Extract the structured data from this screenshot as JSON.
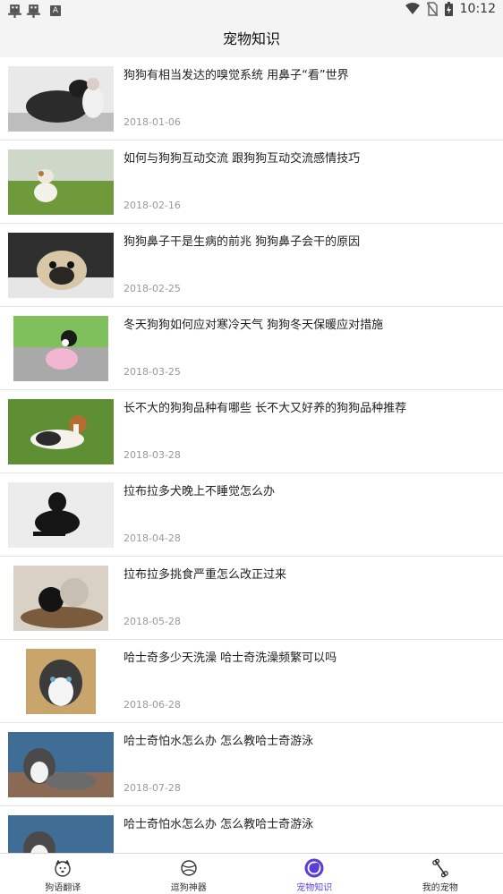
{
  "status_bar": {
    "time": "10:12",
    "left_icons": [
      "bug-icon",
      "bug-icon",
      "a-notification-icon"
    ],
    "right_icons": [
      "wifi-icon",
      "no-sim-icon",
      "battery-icon"
    ]
  },
  "header": {
    "title": "宠物知识"
  },
  "articles": [
    {
      "title": "狗狗有相当发达的嗅觉系统 用鼻子“看”世界",
      "date": "2018-01-06",
      "thumb": "dog-hugging-child-photo"
    },
    {
      "title": "如何与狗狗互动交流 跟狗狗互动交流感情技巧",
      "date": "2018-02-16",
      "thumb": "terrier-on-grass-photo"
    },
    {
      "title": "狗狗鼻子干是生病的前兆 狗狗鼻子会干的原因",
      "date": "2018-02-25",
      "thumb": "pug-lying-photo"
    },
    {
      "title": "冬天狗狗如何应对寒冷天气 狗狗冬天保暖应对措施",
      "date": "2018-03-25",
      "thumb": "dog-in-pink-sweater-photo"
    },
    {
      "title": "长不大的狗狗品种有哪些 长不大又好养的狗狗品种推荐",
      "date": "2018-03-28",
      "thumb": "beagle-on-grass-photo"
    },
    {
      "title": "拉布拉多犬晚上不睡觉怎么办",
      "date": "2018-04-28",
      "thumb": "black-labrador-photo"
    },
    {
      "title": "拉布拉多挑食严重怎么改正过来",
      "date": "2018-05-28",
      "thumb": "poodles-in-basket-photo"
    },
    {
      "title": "哈士奇多少天洗澡 哈士奇洗澡频繁可以吗",
      "date": "2018-06-28",
      "thumb": "husky-face-photo"
    },
    {
      "title": "哈士奇怕水怎么办 怎么教哈士奇游泳",
      "date": "2018-07-28",
      "thumb": "husky-lying-photo"
    },
    {
      "title": "哈士奇怕水怎么办 怎么教哈士奇游泳",
      "date": "",
      "thumb": "husky-lying-photo"
    }
  ],
  "bottom_nav": [
    {
      "label": "狗语翻译",
      "icon": "dog-face-icon",
      "active": false
    },
    {
      "label": "逗狗神器",
      "icon": "ball-icon",
      "active": false
    },
    {
      "label": "宠物知识",
      "icon": "knowledge-icon",
      "active": true
    },
    {
      "label": "我的宠物",
      "icon": "bone-icon",
      "active": false
    }
  ],
  "colors": {
    "accent": "#5a3fd6",
    "divider": "#e2e2e2",
    "date_text": "#999999",
    "bar_bg": "#f4f4f4"
  }
}
